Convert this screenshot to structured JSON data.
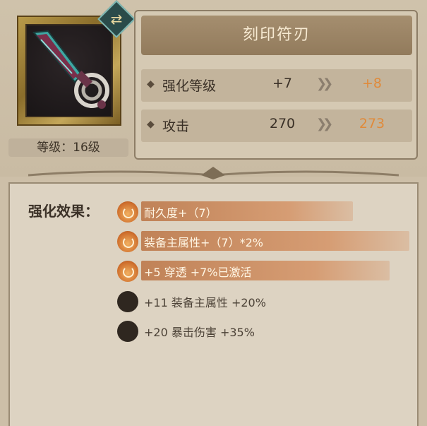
{
  "item": {
    "name": "刻印符刃",
    "level_label": "等级：16级"
  },
  "stats": [
    {
      "label": "强化等级",
      "current": "+7",
      "next": "+8"
    },
    {
      "label": "攻击",
      "current": "270",
      "next": "273"
    }
  ],
  "effects": {
    "title": "强化效果：",
    "items": [
      {
        "text": "耐久度+（7）",
        "active": true
      },
      {
        "text": "装备主属性+（7）*2%",
        "active": true
      },
      {
        "text": "+5  穿透 +7%已激活",
        "active": true
      },
      {
        "text": "+11  装备主属性 +20%",
        "active": false
      },
      {
        "text": "+20  暴击伤害 +35%",
        "active": false
      }
    ]
  },
  "colors": {
    "next_value": "#e08a3a",
    "active_icon": "#cc6b2a",
    "inactive_icon": "#2f2720"
  }
}
